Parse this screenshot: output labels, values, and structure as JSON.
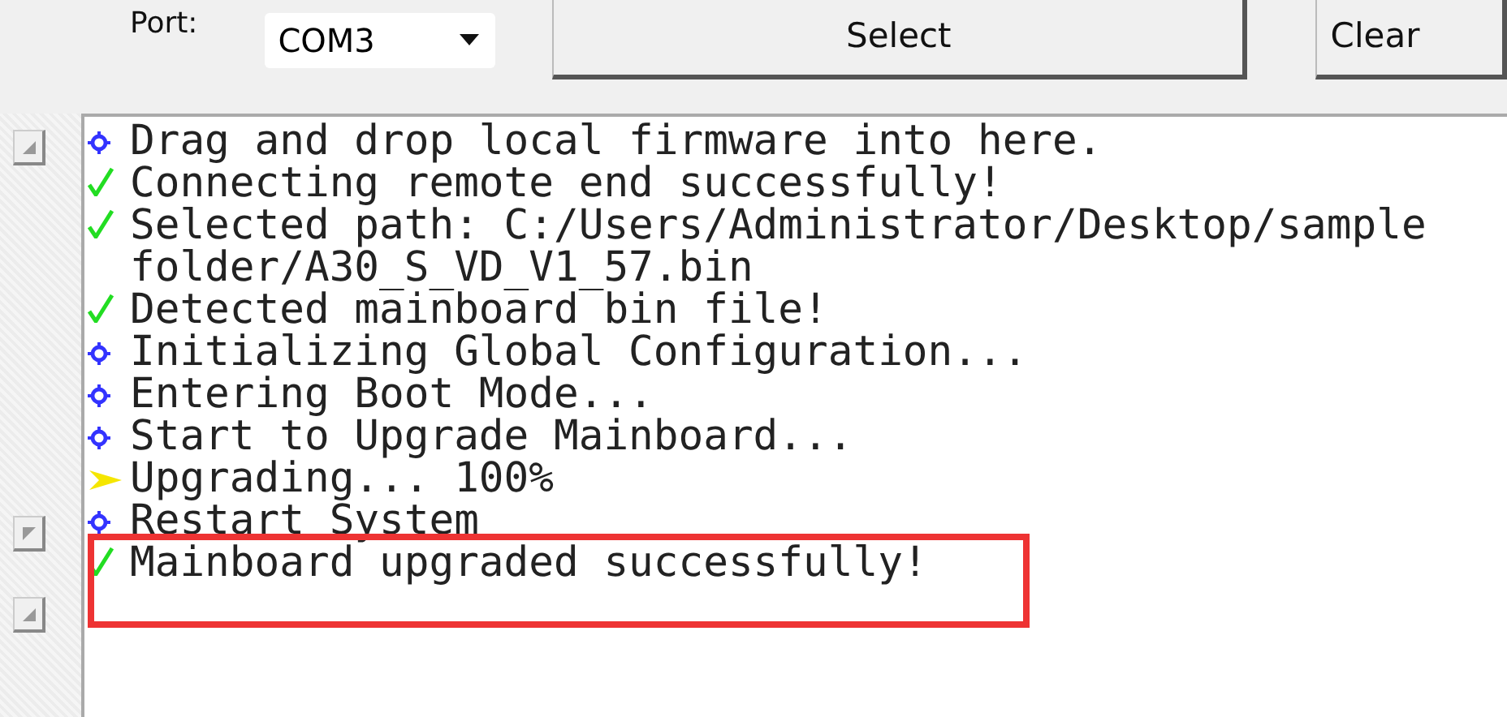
{
  "toolbar": {
    "port_label": "Port:",
    "port_value": "COM3",
    "buttons": [
      "Select",
      "Clear"
    ]
  },
  "side_buttons": [
    {
      "kind": "up"
    },
    {
      "kind": "down"
    },
    {
      "kind": "up"
    }
  ],
  "log": [
    {
      "kind": "info",
      "text": "Drag and drop local firmware into here.",
      "highlighted": false
    },
    {
      "kind": "success",
      "text": "Connecting remote end successfully!",
      "highlighted": false
    },
    {
      "kind": "success",
      "text": "Selected path: C:/Users/Administrator/Desktop/sample folder/A30_S_VD_V1_57.bin",
      "highlighted": false
    },
    {
      "kind": "success",
      "text": "Detected mainboard bin file!",
      "highlighted": false
    },
    {
      "kind": "info",
      "text": "Initializing Global Configuration...",
      "highlighted": false
    },
    {
      "kind": "info",
      "text": "Entering Boot Mode...",
      "highlighted": false
    },
    {
      "kind": "info",
      "text": "Start to Upgrade Mainboard...",
      "highlighted": false
    },
    {
      "kind": "progress",
      "text": "Upgrading... 100%",
      "highlighted": false
    },
    {
      "kind": "info",
      "text": "Restart System",
      "highlighted": false
    },
    {
      "kind": "success",
      "text": "Mainboard upgraded successfully!",
      "highlighted": true
    }
  ]
}
